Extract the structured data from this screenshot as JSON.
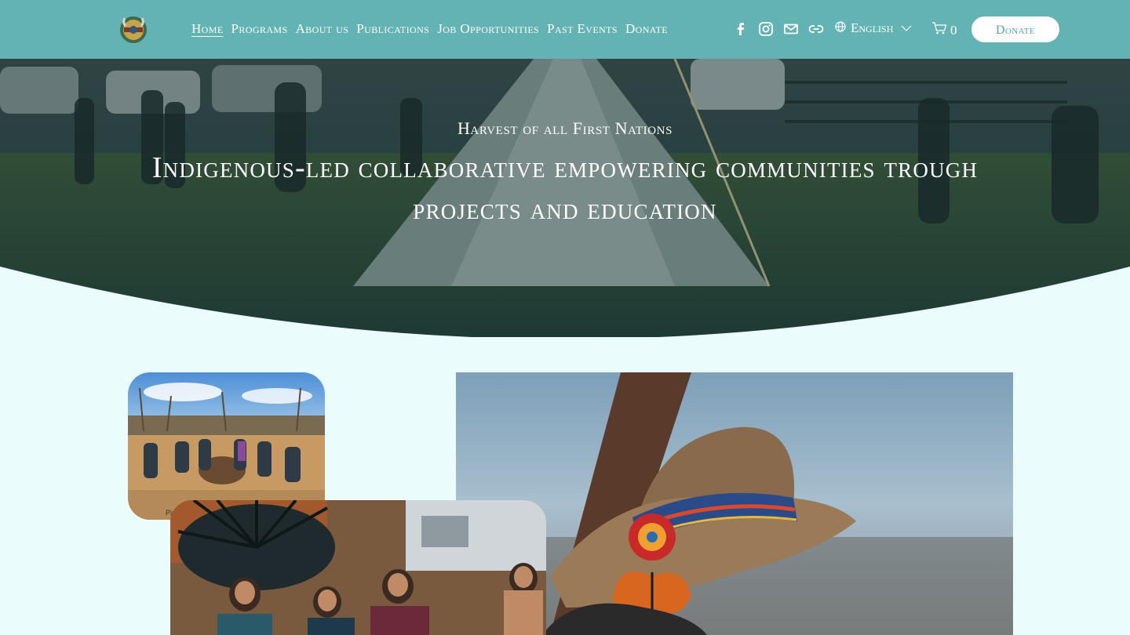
{
  "header": {
    "logo_icon": "circular-medallion-logo",
    "nav": [
      {
        "label": "Home",
        "active": true
      },
      {
        "label": "Programs"
      },
      {
        "label": "About us"
      },
      {
        "label": "Publications"
      },
      {
        "label": "Job Opportunities"
      },
      {
        "label": "Past Events"
      },
      {
        "label": "Donate"
      }
    ],
    "social_icons": [
      "facebook-icon",
      "instagram-icon",
      "email-icon",
      "link-icon"
    ],
    "language": {
      "icon": "globe-icon",
      "selected": "English",
      "chevron": "chevron-down-icon"
    },
    "cart": {
      "icon": "cart-icon",
      "count": "0"
    },
    "donate_button": "Donate"
  },
  "hero": {
    "subtitle": "Harvest of all First Nations",
    "title": "Indigenous-led collaborative empowering communities trough projects and education"
  },
  "gallery": {
    "photo_a_caption_fragment": "Pic"
  },
  "colors": {
    "header_bg": "#63b3b5",
    "page_bg": "#eafcfb",
    "accent": "#5aa7aa"
  }
}
